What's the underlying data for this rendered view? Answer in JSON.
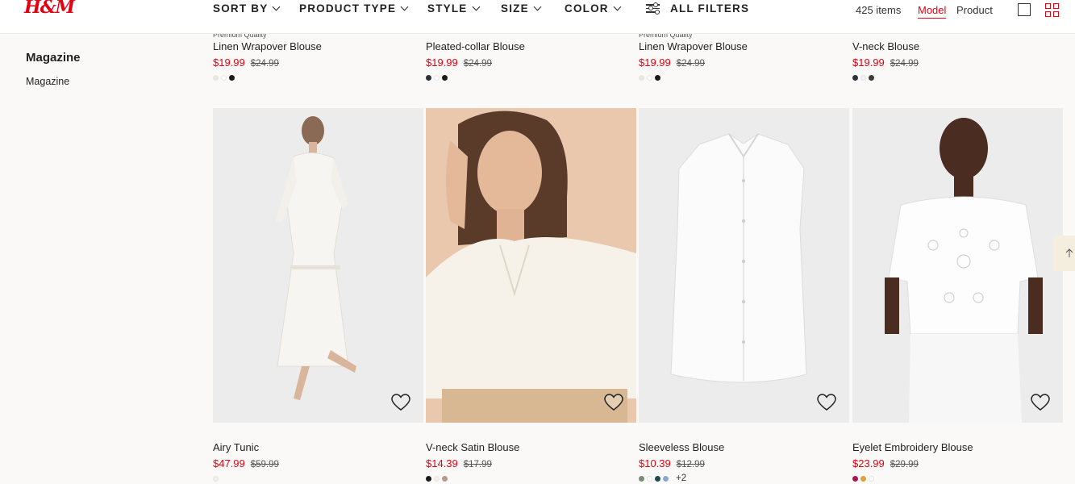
{
  "brand": {
    "logo": "H&M",
    "accent": "#e50010"
  },
  "filters": [
    "SORT BY",
    "PRODUCT TYPE",
    "STYLE",
    "SIZE",
    "COLOR"
  ],
  "all_filters": "ALL FILTERS",
  "item_count": "425 items",
  "view": {
    "model": "Model",
    "product": "Product"
  },
  "sidebar": {
    "heading": "Magazine",
    "link": "Magazine"
  },
  "top_row": [
    {
      "premium": "Premium Quality",
      "name": "Linen Wrapover Blouse",
      "price": "$19.99",
      "old_price": "$24.99",
      "swatches": [
        "#ece6dc",
        "#ffffff",
        "#1a1a1a"
      ]
    },
    {
      "premium": "",
      "name": "Pleated-collar Blouse",
      "price": "$19.99",
      "old_price": "$24.99",
      "swatches": [
        "#2a2f3a",
        "#ffffff",
        "#1a1a1a"
      ]
    },
    {
      "premium": "Premium Quality",
      "name": "Linen Wrapover Blouse",
      "price": "$19.99",
      "old_price": "$24.99",
      "swatches": [
        "#ece6dc",
        "#ffffff",
        "#1a1a1a"
      ]
    },
    {
      "premium": "",
      "name": "V-neck Blouse",
      "price": "$19.99",
      "old_price": "$24.99",
      "swatches": [
        "#2b3140",
        "#f2f2f2",
        "#3a3a3a"
      ]
    }
  ],
  "bottom_row": [
    {
      "name": "Airy Tunic",
      "price": "$47.99",
      "old_price": "$59.99",
      "swatches": [
        "#f0f0f0"
      ],
      "more": ""
    },
    {
      "name": "V-neck Satin Blouse",
      "price": "$14.39",
      "old_price": "$17.99",
      "swatches": [
        "#1a1a1a",
        "#f4efe6",
        "#b89a8a"
      ],
      "more": ""
    },
    {
      "name": "Sleeveless Blouse",
      "price": "$10.39",
      "old_price": "$12.99",
      "swatches": [
        "#7d8c7a",
        "#ffffff",
        "#1f4a4a",
        "#8aa6d8"
      ],
      "more": "+2"
    },
    {
      "name": "Eyelet Embroidery Blouse",
      "price": "$23.99",
      "old_price": "$29.99",
      "swatches": [
        "#a8154f",
        "#e0a03a",
        "#ffffff"
      ],
      "more": ""
    }
  ]
}
